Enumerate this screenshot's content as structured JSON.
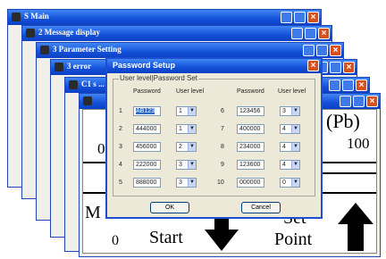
{
  "windows": [
    {
      "title": "S Main"
    },
    {
      "title": "2 Message display"
    },
    {
      "title": "3 Parameter Setting"
    },
    {
      "title": "3 error"
    },
    {
      "title": "C1 s ..."
    },
    {
      "title": ""
    }
  ],
  "display": {
    "lbl_pb": "(Pb)",
    "val_100": "100",
    "val_0a": "0",
    "lbl_m": "M",
    "val_0b": "0",
    "lbl_start": "Start",
    "lbl_set": "Set",
    "lbl_point": "Point"
  },
  "dialog": {
    "title": "Password Setup",
    "group_label": "User level|Password Set",
    "col_password": "Password",
    "col_user_level": "User level",
    "rows_left": [
      {
        "num": "1",
        "password": "AB123",
        "level": "1"
      },
      {
        "num": "2",
        "password": "444000",
        "level": "1"
      },
      {
        "num": "3",
        "password": "456000",
        "level": "2"
      },
      {
        "num": "4",
        "password": "222000",
        "level": "3"
      },
      {
        "num": "5",
        "password": "888000",
        "level": "3"
      }
    ],
    "rows_right": [
      {
        "num": "6",
        "password": "123456",
        "level": "3"
      },
      {
        "num": "7",
        "password": "400000",
        "level": "4"
      },
      {
        "num": "8",
        "password": "234000",
        "level": "4"
      },
      {
        "num": "9",
        "password": "123600",
        "level": "4"
      },
      {
        "num": "10",
        "password": "000000",
        "level": "0"
      }
    ],
    "ok_label": "OK",
    "cancel_label": "Cancel",
    "close_glyph": "×",
    "dropdown_glyph": "▼"
  }
}
